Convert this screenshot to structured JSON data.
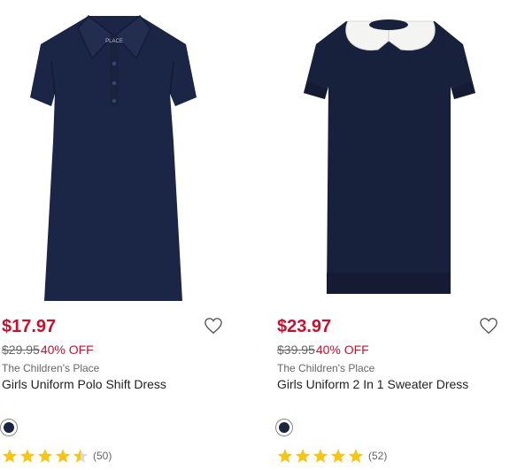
{
  "colors": {
    "sale": "#c8102e",
    "navy": "#1a2540",
    "star": "#f5c518"
  },
  "products": [
    {
      "price": "$17.97",
      "was_price": "$29.95",
      "discount": "40% OFF",
      "brand": "The Children's Place",
      "name": "Girls Uniform Polo Shift Dress",
      "rating": 4.5,
      "review_count": "(50)",
      "swatch_color": "#1a2540",
      "collar_label": "PLACE",
      "icon": "heart-icon"
    },
    {
      "price": "$23.97",
      "was_price": "$39.95",
      "discount": "40% OFF",
      "brand": "The Children's Place",
      "name": "Girls Uniform 2 In 1 Sweater Dress",
      "rating": 5,
      "review_count": "(52)",
      "swatch_color": "#1a2540",
      "icon": "heart-icon"
    }
  ]
}
